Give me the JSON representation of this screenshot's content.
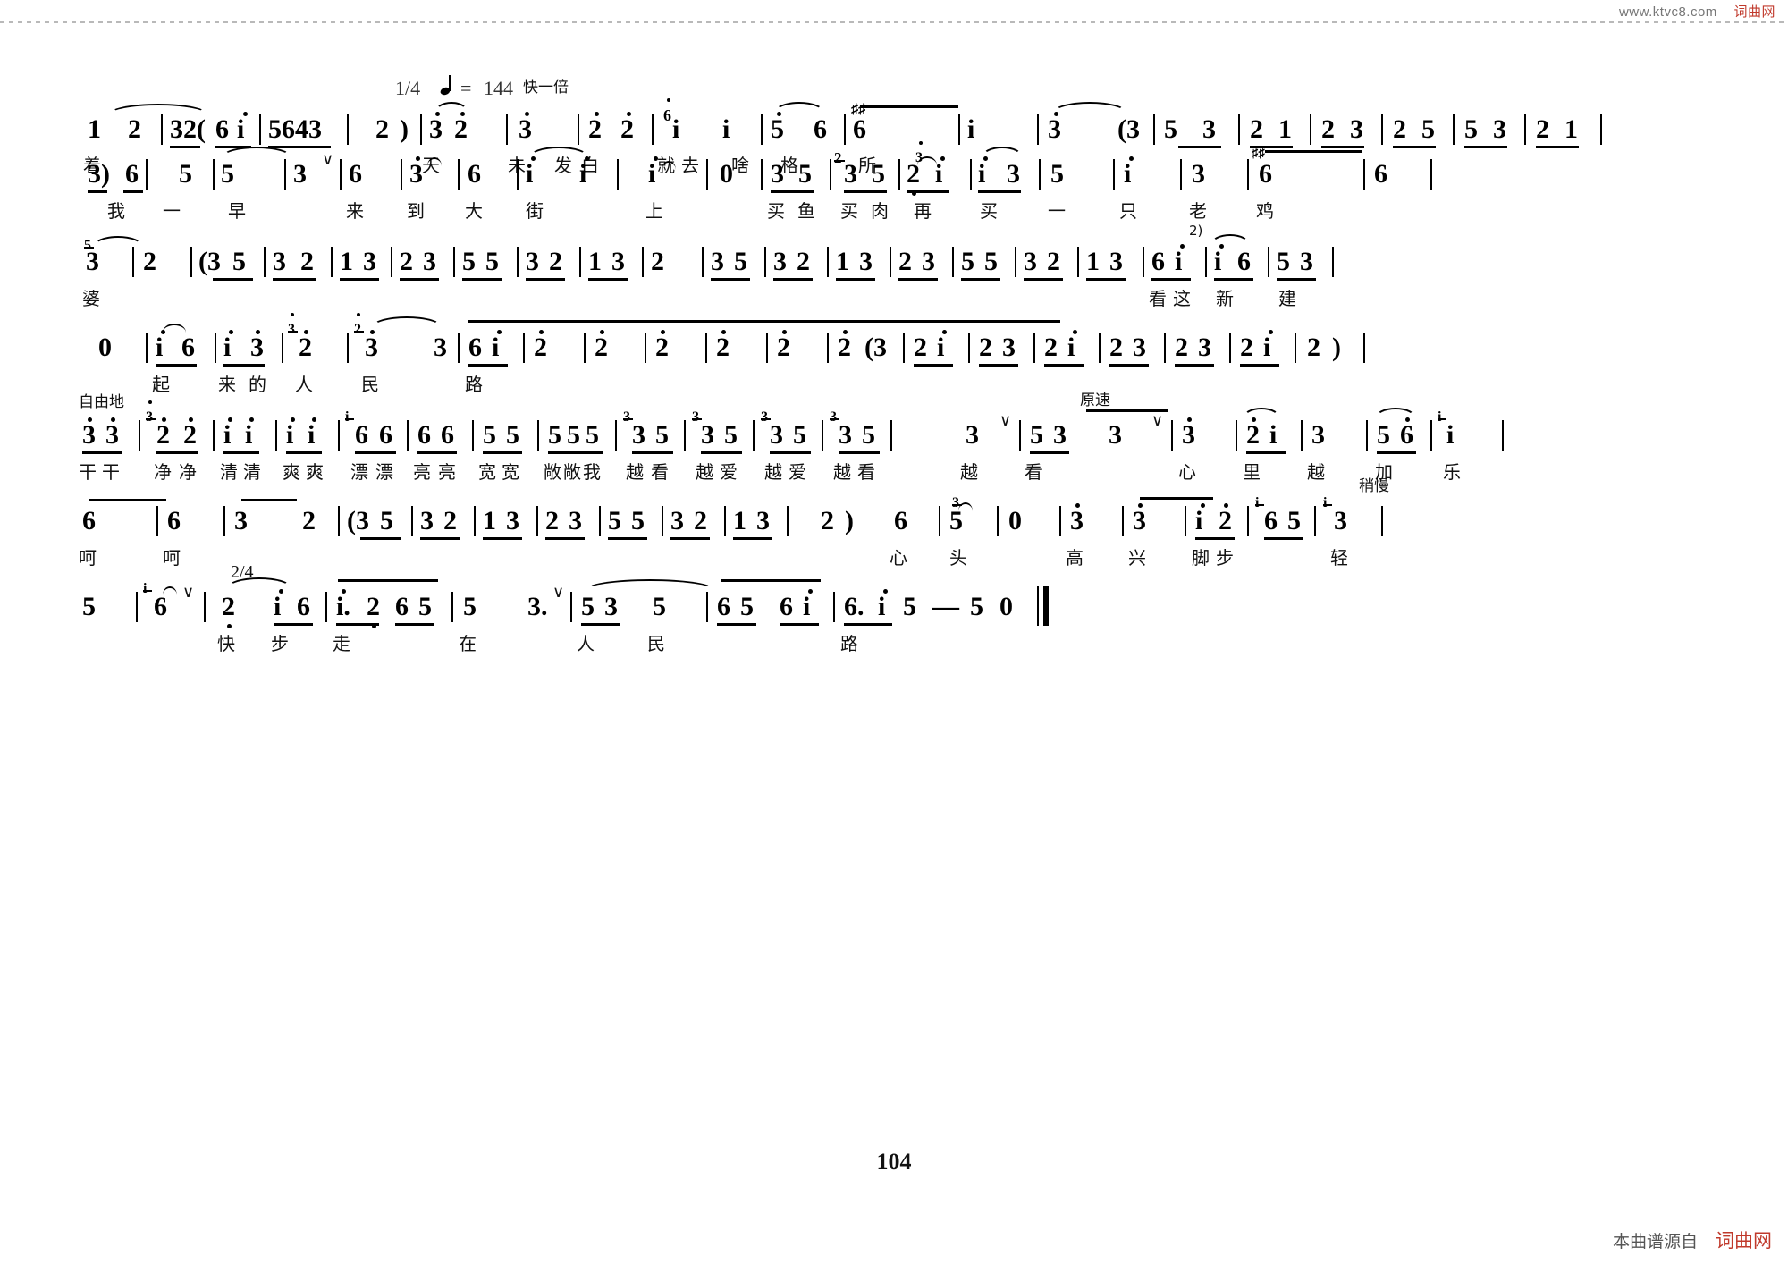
{
  "watermark": {
    "top_url": "www.ktvc8.com",
    "top_site": "词曲网",
    "bottom_text": "本曲谱源自",
    "bottom_site": "词曲网"
  },
  "page": {
    "number": "104"
  },
  "tempo": {
    "meter_change": "1/4",
    "note_symbol": "♩",
    "equals": "=",
    "bpm": "144",
    "note_cn": "快一倍"
  },
  "expression_marks": [
    {
      "text": "自由地",
      "row": 5
    },
    {
      "text": "原速",
      "row": 5
    },
    {
      "text": "稍慢",
      "row": 6
    },
    {
      "text": "2/4",
      "row": 7
    }
  ],
  "score": {
    "rows": [
      {
        "id": "row-1",
        "notes": [
          "1",
          "2",
          "32(",
          "6",
          "i",
          "5643",
          "2",
          ")",
          "3",
          "2",
          "3",
          "2",
          "2",
          "6",
          "i",
          "i",
          "5",
          "6",
          "6",
          "i",
          "3",
          "(3",
          "5",
          "3",
          "2",
          "1",
          "2",
          "3",
          "2",
          "5",
          "5",
          "3",
          "2",
          "1",
          "2"
        ],
        "lyrics": [
          "着",
          "天",
          "未",
          "发",
          "白",
          "就",
          "去",
          "啥",
          "格",
          "所"
        ]
      },
      {
        "id": "row-2",
        "notes": [
          "3)",
          "6",
          "5",
          "5",
          "3",
          "6",
          "3",
          "6",
          "i",
          "i",
          "i",
          "0",
          "3",
          "5",
          "3",
          "5",
          "2",
          "2",
          "i",
          "3",
          "5",
          "i",
          "3",
          "6",
          "6"
        ],
        "lyrics": [
          "我",
          "一",
          "早",
          "来",
          "到",
          "大",
          "街",
          "上",
          "买",
          "鱼",
          "买",
          "肉",
          "再",
          "买",
          "一",
          "只",
          "老",
          "鸡"
        ],
        "annotation": "2)"
      },
      {
        "id": "row-3",
        "notes": [
          "3",
          "2",
          "(3",
          "5",
          "3",
          "2",
          "1",
          "3",
          "2",
          "3",
          "5",
          "5",
          "3",
          "2",
          "1",
          "3",
          "2",
          "3",
          "5",
          "3",
          "2",
          "1",
          "3",
          "2",
          "3",
          "5",
          "5",
          "3",
          "2",
          "1",
          "3",
          "6",
          "i",
          "i",
          "6",
          "5",
          "3"
        ],
        "lyrics": [
          "婆",
          "看",
          "这",
          "新",
          "建"
        ]
      },
      {
        "id": "row-4",
        "notes": [
          "0",
          "i",
          "6",
          "i",
          "3",
          "3",
          "2",
          "2",
          "3",
          "3",
          "6",
          "i",
          "2",
          "2",
          "2",
          "2",
          "2",
          "2",
          "(3",
          "2",
          "i",
          "2",
          "3",
          "2",
          "i",
          "2",
          "3",
          "2",
          "3",
          "2",
          "i",
          "2",
          ")"
        ],
        "lyrics": [
          "起",
          "来",
          "的",
          "人",
          "民",
          "路"
        ]
      },
      {
        "id": "row-5",
        "notes": [
          "3",
          "3",
          "2",
          "2",
          "i",
          "i",
          "i",
          "i",
          "i",
          "6",
          "6",
          "6",
          "6",
          "5",
          "5",
          "5",
          "5",
          "5",
          "3",
          "5",
          "3",
          "5",
          "3",
          "5",
          "3",
          "5",
          "3",
          "5",
          "3",
          "3",
          "3",
          "2",
          "i",
          "3",
          "5",
          "6",
          "i",
          "i",
          "3"
        ],
        "lyrics": [
          "干",
          "干",
          "净",
          "净",
          "清",
          "清",
          "爽",
          "爽",
          "漂",
          "漂",
          "亮",
          "亮",
          "宽",
          "宽",
          "敞",
          "敞",
          "我",
          "越",
          "看",
          "越",
          "爱",
          "越",
          "爱",
          "越",
          "看",
          "越",
          "看",
          "心",
          "里",
          "越",
          "加",
          "乐"
        ]
      },
      {
        "id": "row-6",
        "notes": [
          "6",
          "6",
          "3",
          "2",
          "(3",
          "5",
          "3",
          "2",
          "1",
          "3",
          "2",
          "3",
          "5",
          "5",
          "3",
          "2",
          "1",
          "3",
          "2",
          ")",
          "6",
          "5",
          "3",
          "0",
          "3",
          "3",
          "2",
          "i",
          "2",
          "i",
          "6",
          "5",
          "i",
          "3"
        ],
        "lyrics": [
          "呵",
          "呵",
          "心",
          "头",
          "高",
          "兴",
          "脚",
          "步",
          "轻"
        ]
      },
      {
        "id": "row-7",
        "notes": [
          "5",
          "i",
          "6",
          "2",
          "i",
          "6",
          "i.",
          "2",
          "6",
          "5",
          "5",
          "3.",
          "5",
          "3",
          "5",
          "6",
          "5",
          "6",
          "i",
          "6.",
          "i",
          "5",
          "5",
          "—",
          "5",
          "0"
        ],
        "lyrics": [
          "快",
          "步",
          "走",
          "在",
          "人",
          "民",
          "路"
        ]
      }
    ]
  }
}
